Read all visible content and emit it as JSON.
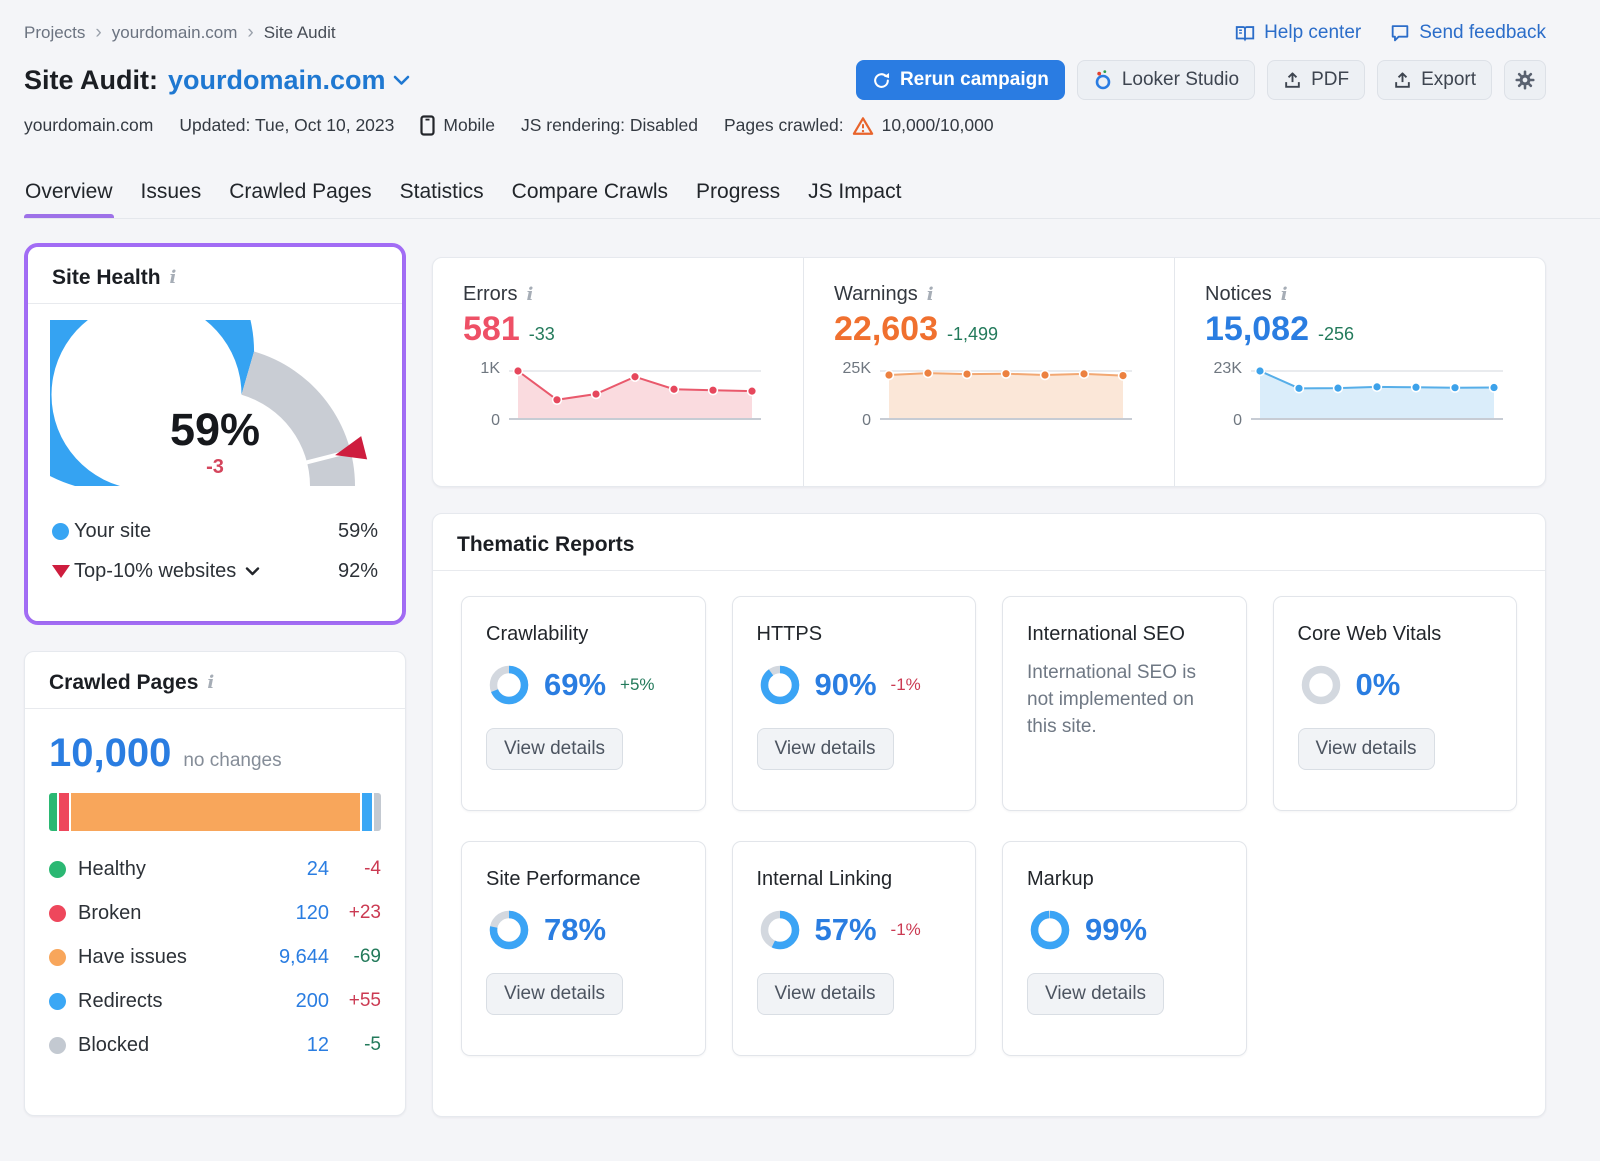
{
  "breadcrumb": {
    "items": [
      {
        "label": "Projects"
      },
      {
        "label": "yourdomain.com"
      },
      {
        "label": "Site Audit"
      }
    ]
  },
  "top_links": {
    "help_center": "Help center",
    "send_feedback": "Send feedback"
  },
  "header": {
    "title_prefix": "Site Audit:",
    "title_domain": "yourdomain.com",
    "buttons": {
      "rerun": "Rerun campaign",
      "looker": "Looker Studio",
      "pdf": "PDF",
      "export": "Export"
    },
    "meta": {
      "domain": "yourdomain.com",
      "updated": "Updated: Tue, Oct 10, 2023",
      "device": "Mobile",
      "js_rendering": "JS rendering: Disabled",
      "pages_crawled_label": "Pages crawled:",
      "pages_crawled": "10,000/10,000"
    }
  },
  "tabs": [
    {
      "label": "Overview",
      "active": true
    },
    {
      "label": "Issues"
    },
    {
      "label": "Crawled Pages"
    },
    {
      "label": "Statistics"
    },
    {
      "label": "Compare Crawls"
    },
    {
      "label": "Progress"
    },
    {
      "label": "JS Impact"
    }
  ],
  "site_health": {
    "title": "Site Health",
    "score_percent": 59,
    "score_label": "59%",
    "delta": "-3",
    "benchmark_percent": 92,
    "colors": {
      "score": "#35a3f2",
      "track": "#c9cdd4",
      "marker": "#ce1d3e"
    },
    "legend": [
      {
        "label": "Your site",
        "value": "59%"
      },
      {
        "label": "Top-10% websites",
        "value": "92%"
      }
    ]
  },
  "issues": [
    {
      "label": "Errors",
      "value": "581",
      "delta": "-33",
      "axis_max": "1K",
      "axis_min": "0",
      "max": 1000,
      "values": [
        1000,
        400,
        520,
        880,
        620,
        600,
        581
      ],
      "line_color": "#e9596c",
      "dot_color": "#e6475c",
      "fill_color": "#fadbdf"
    },
    {
      "label": "Warnings",
      "value": "22,603",
      "delta": "-1,499",
      "axis_max": "25K",
      "axis_min": "0",
      "max": 25000,
      "values": [
        22900,
        23900,
        23400,
        23600,
        22900,
        23500,
        22603
      ],
      "line_color": "#f2a873",
      "dot_color": "#ec8140",
      "fill_color": "#fbe7d8"
    },
    {
      "label": "Notices",
      "value": "15,082",
      "delta": "-256",
      "axis_max": "23K",
      "axis_min": "0",
      "max": 23000,
      "values": [
        23000,
        14700,
        14800,
        15400,
        15200,
        15000,
        15082
      ],
      "line_color": "#56aee8",
      "dot_color": "#3da2ea",
      "fill_color": "#daedfa"
    }
  ],
  "thematic": {
    "title": "Thematic Reports",
    "view_details": "View details",
    "cards": [
      {
        "title": "Crawlability",
        "percent": 69,
        "percent_label": "69%",
        "delta": "+5%"
      },
      {
        "title": "HTTPS",
        "percent": 90,
        "percent_label": "90%",
        "delta": "-1%"
      },
      {
        "title": "International SEO",
        "note": "International SEO is not implemented on this site."
      },
      {
        "title": "Core Web Vitals",
        "percent": 0,
        "percent_label": "0%"
      },
      {
        "title": "Site Performance",
        "percent": 78,
        "percent_label": "78%"
      },
      {
        "title": "Internal Linking",
        "percent": 57,
        "percent_label": "57%",
        "delta": "-1%"
      },
      {
        "title": "Markup",
        "percent": 99,
        "percent_label": "99%"
      }
    ],
    "ring_colors": {
      "progress": "#3ba4f5",
      "track": "#d3d8df"
    }
  },
  "crawled_pages": {
    "title": "Crawled Pages",
    "total": "10,000",
    "total_note": "no changes",
    "bar": [
      {
        "name": "Healthy",
        "color": "#2bb873",
        "width": 2.3
      },
      {
        "name": "Broken",
        "color": "#ee475c",
        "width": 3.0
      },
      {
        "name": "Have issues",
        "color": "#f8a65b",
        "width": 87.6
      },
      {
        "name": "Redirects",
        "color": "#3aa7f5",
        "width": 3.1
      },
      {
        "name": "Blocked",
        "color": "#c3c9d1",
        "width": 2.0
      }
    ],
    "legend": [
      {
        "label": "Healthy",
        "value": "24",
        "delta": "-4",
        "color": "#2bb873"
      },
      {
        "label": "Broken",
        "value": "120",
        "delta": "+23",
        "color": "#ee475c"
      },
      {
        "label": "Have issues",
        "value": "9,644",
        "delta": "-69",
        "color": "#f8a65b"
      },
      {
        "label": "Redirects",
        "value": "200",
        "delta": "+55",
        "color": "#3aa7f5"
      },
      {
        "label": "Blocked",
        "value": "12",
        "delta": "-5",
        "color": "#c3c9d1"
      }
    ]
  },
  "icons": {
    "book-icon": "open book",
    "chat-icon": "speech bubble",
    "refresh-icon": "circular arrow",
    "upload-icon": "arrow up from tray",
    "gear-icon": "settings gear",
    "phone-icon": "mobile phone",
    "warning-icon": "orange warning triangle",
    "info-icon": "gray i",
    "chevron-down-icon": "v chevron",
    "triangle-down-icon": "red triangle"
  }
}
